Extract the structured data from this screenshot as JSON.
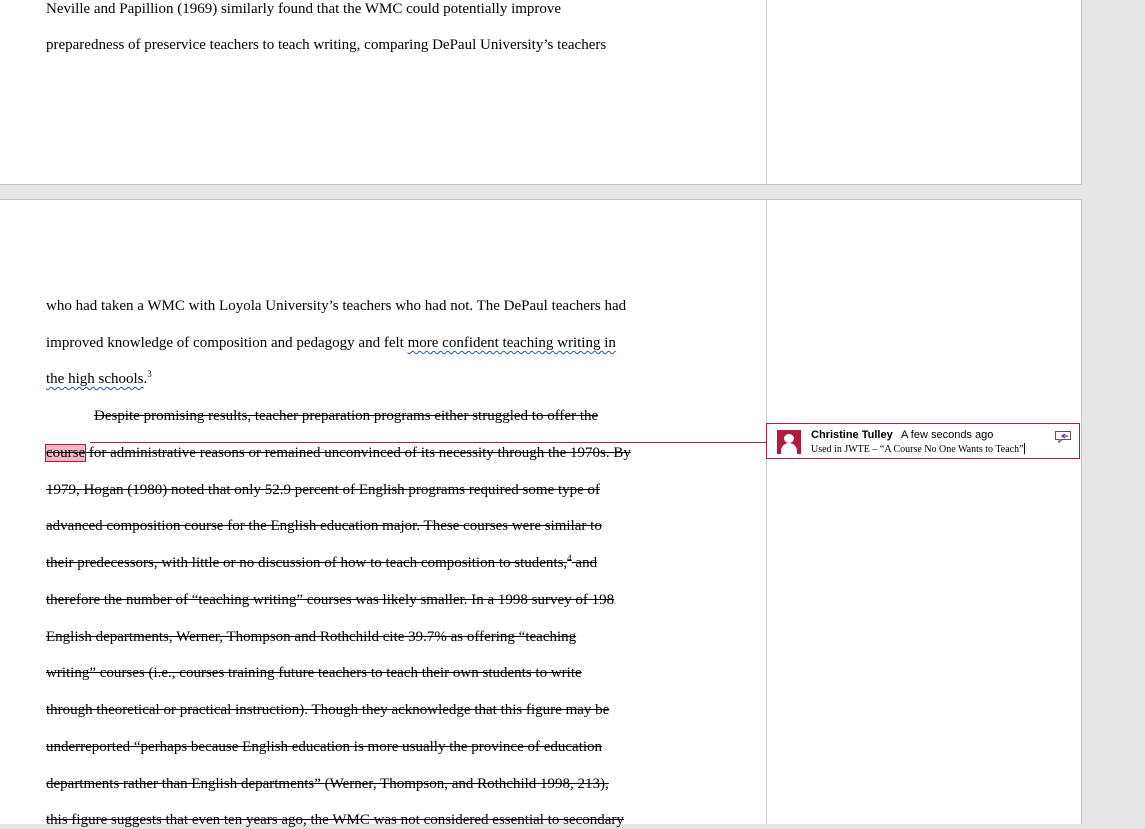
{
  "page1": {
    "lines": [
      "Neville and Papillion (1969) similarly found that the WMC could potentially improve",
      "preparedness of preservice teachers to teach writing, comparing DePaul University’s teachers"
    ]
  },
  "page2": {
    "line1": "who had taken a WMC with Loyola University’s teachers who had not. The DePaul teachers had",
    "line2a": "improved knowledge of composition and pedagogy and felt ",
    "line2b": "more confident teaching writing in",
    "line3a": "the high schools",
    "line3sup": "3",
    "line4": "Despite promising results, teacher preparation programs either struggled to offer the",
    "line5anchor": "course",
    "line5rest": " for administrative reasons or remained unconvinced of its necessity through the 1970s. By",
    "line6": "1979, Hogan (1980) noted that only 52.9 percent of English programs required some type of",
    "line7": "advanced composition course for the English education major. These courses were similar to",
    "line8a": "their predecessors, with little or no discussion of how to teach composition to students,",
    "line8sup": "4",
    "line8b": " and",
    "line9": "therefore the number of “teaching writing” courses was likely smaller. In a 1998 survey of 198",
    "line10": "English departments, Werner, Thompson and Rothchild cite 39.7%  as offering “teaching",
    "line11": "writing” courses (i.e., courses training future teachers to teach their own students to write",
    "line12": "through theoretical or practical instruction). Though they acknowledge that this figure may be",
    "line13": "underreported “perhaps because English education is more usually the province of education",
    "line14": "departments rather than English departments” (Werner, Thompson, and Rothchild 1998, 213),",
    "line15": "this figure suggests that even ten years ago, the WMC was not considered essential to secondary"
  },
  "comment": {
    "author": "Christine Tulley",
    "time": "A few seconds ago",
    "text": "Used in JWTE – “A Course No One Wants to Teach”",
    "accent_color": "#b01c3e",
    "avatar_icon": "person-icon",
    "reply_icon": "reply-comment-icon"
  }
}
